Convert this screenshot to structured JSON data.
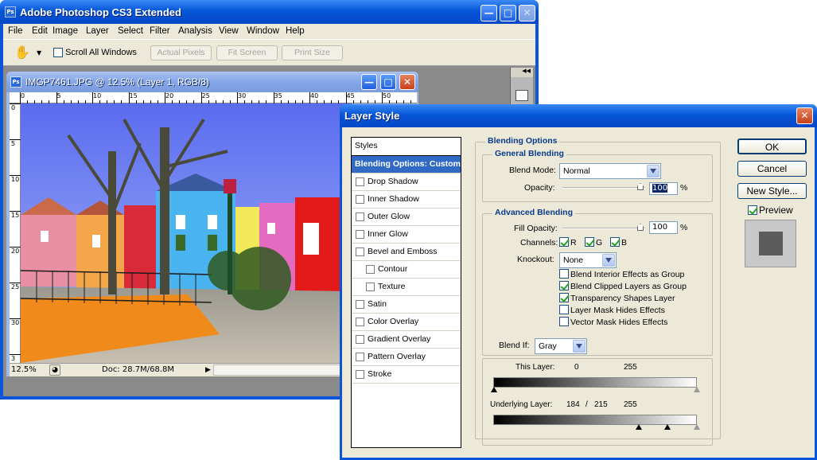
{
  "app": {
    "title": "Adobe Photoshop CS3 Extended"
  },
  "menu": [
    "File",
    "Edit",
    "Image",
    "Layer",
    "Select",
    "Filter",
    "Analysis",
    "View",
    "Window",
    "Help"
  ],
  "options": {
    "scroll_all": "Scroll All Windows",
    "actual": "Actual Pixels",
    "fit": "Fit Screen",
    "print": "Print Size"
  },
  "document": {
    "title": "IMGP7461.JPG @ 12.5% (Layer 1, RGB/8)",
    "ruler_h": [
      "0",
      "5",
      "10",
      "15",
      "20",
      "25",
      "30",
      "35",
      "40",
      "45",
      "50"
    ],
    "ruler_v": [
      "0",
      "5",
      "10",
      "15",
      "20",
      "25",
      "30",
      "3"
    ],
    "zoom": "12.5%",
    "doc_info": "Doc: 28.7M/68.8M"
  },
  "dialog": {
    "title": "Layer Style",
    "styles_header": "Styles",
    "styles": [
      {
        "label": "Blending Options: Custom",
        "selected": true
      },
      {
        "label": "Drop Shadow"
      },
      {
        "label": "Inner Shadow"
      },
      {
        "label": "Outer Glow"
      },
      {
        "label": "Inner Glow"
      },
      {
        "label": "Bevel and Emboss"
      },
      {
        "label": "Contour",
        "indent": true
      },
      {
        "label": "Texture",
        "indent": true
      },
      {
        "label": "Satin"
      },
      {
        "label": "Color Overlay"
      },
      {
        "label": "Gradient Overlay"
      },
      {
        "label": "Pattern Overlay"
      },
      {
        "label": "Stroke"
      }
    ],
    "blending_options": "Blending Options",
    "general_blending": "General Blending",
    "blend_mode_label": "Blend Mode:",
    "blend_mode": "Normal",
    "opacity_label": "Opacity:",
    "opacity": "100",
    "percent": "%",
    "advanced_blending": "Advanced Blending",
    "fill_opacity_label": "Fill Opacity:",
    "fill_opacity": "100",
    "channels_label": "Channels:",
    "channels": [
      "R",
      "G",
      "B"
    ],
    "knockout_label": "Knockout:",
    "knockout": "None",
    "adv_options": [
      {
        "label": "Blend Interior Effects as Group",
        "checked": false
      },
      {
        "label": "Blend Clipped Layers as Group",
        "checked": true
      },
      {
        "label": "Transparency Shapes Layer",
        "checked": true
      },
      {
        "label": "Layer Mask Hides Effects",
        "checked": false
      },
      {
        "label": "Vector Mask Hides Effects",
        "checked": false
      }
    ],
    "blend_if_label": "Blend If:",
    "blend_if": "Gray",
    "this_layer_label": "This Layer:",
    "this_layer_min": "0",
    "this_layer_max": "255",
    "underlying_label": "Underlying Layer:",
    "underlying_a": "184",
    "underlying_sep": "/",
    "underlying_b": "215",
    "underlying_max": "255",
    "ok": "OK",
    "cancel": "Cancel",
    "new_style": "New Style...",
    "preview": "Preview"
  }
}
